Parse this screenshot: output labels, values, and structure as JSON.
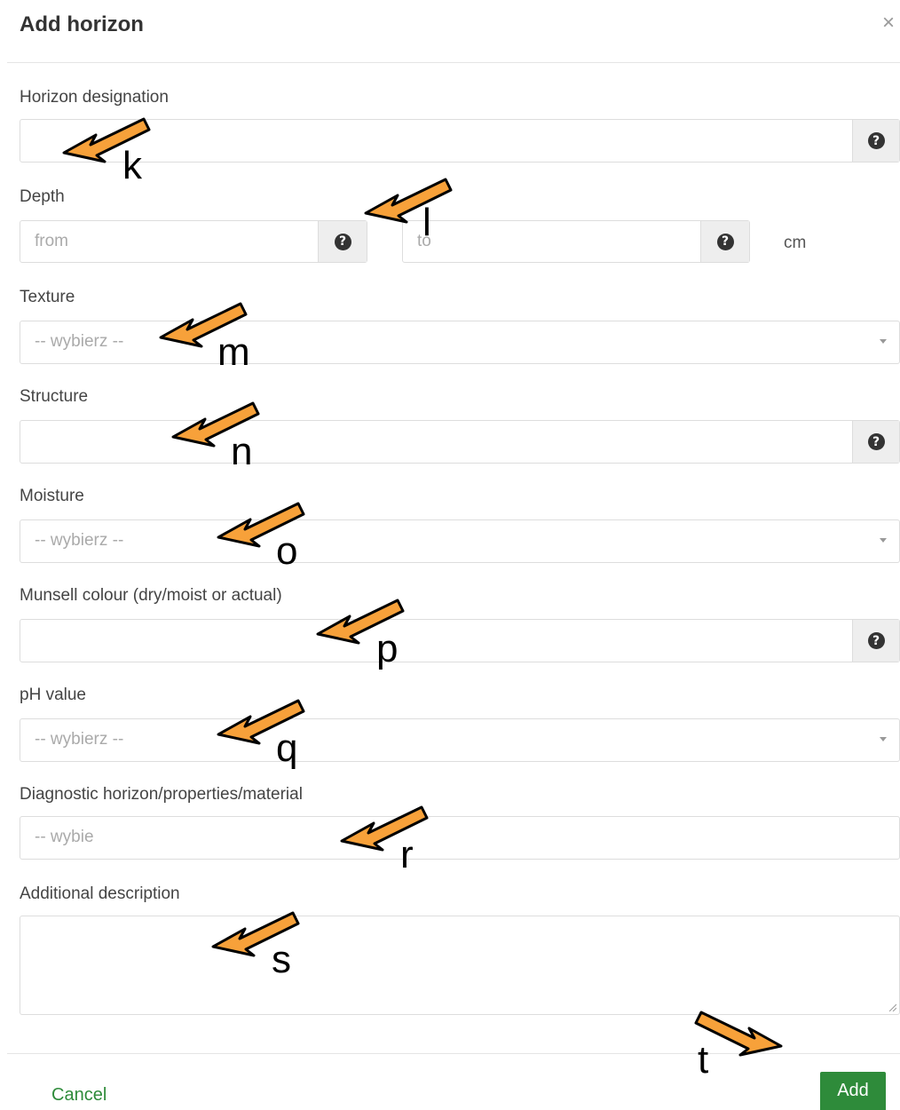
{
  "modal": {
    "title": "Add horizon",
    "close_symbol": "×"
  },
  "fields": {
    "horizon_designation": {
      "label": "Horizon designation",
      "value": ""
    },
    "depth": {
      "label": "Depth",
      "from_placeholder": "from",
      "to_placeholder": "to",
      "unit": "cm"
    },
    "texture": {
      "label": "Texture",
      "selected": "-- wybierz --"
    },
    "structure": {
      "label": "Structure",
      "value": ""
    },
    "moisture": {
      "label": "Moisture",
      "selected": "-- wybierz --"
    },
    "munsell": {
      "label": "Munsell colour (dry/moist or actual)",
      "value": ""
    },
    "ph": {
      "label": "pH value",
      "selected": "-- wybierz --"
    },
    "diagnostic": {
      "label": "Diagnostic horizon/properties/material",
      "placeholder": "-- wybie"
    },
    "additional": {
      "label": "Additional description",
      "value": ""
    }
  },
  "help_icon": "?",
  "footer": {
    "cancel_label": "Cancel",
    "add_label": "Add"
  },
  "annotations": [
    "k",
    "l",
    "m",
    "n",
    "o",
    "p",
    "q",
    "r",
    "s",
    "t"
  ],
  "colors": {
    "accent_green": "#2e8b3a",
    "arrow_orange": "#f7a13a"
  }
}
